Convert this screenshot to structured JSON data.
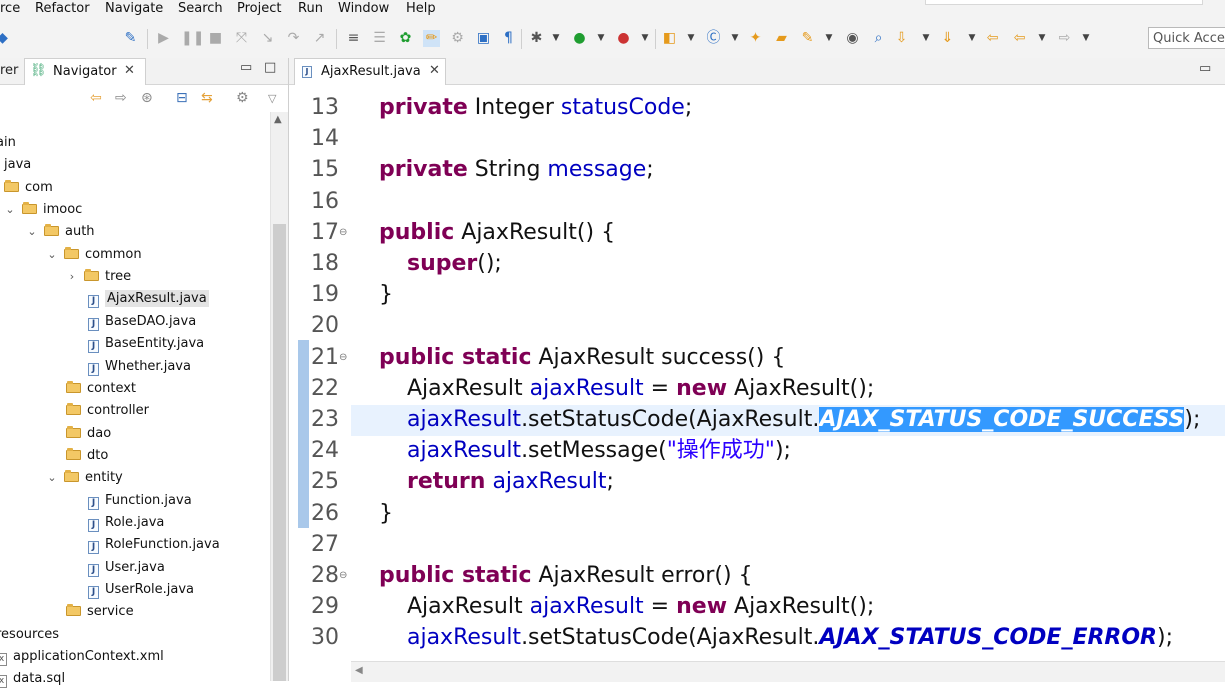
{
  "menu": [
    "rce",
    "Refactor",
    "Navigate",
    "Search",
    "Project",
    "Run",
    "Window",
    "Help"
  ],
  "quick_access": "Quick Access",
  "navigator": {
    "prev_tab": "rer",
    "tab_label": "Navigator",
    "tree": [
      {
        "label": "ain",
        "kind": "text",
        "indent": 0
      },
      {
        "label": "java",
        "kind": "text",
        "indent": 1
      },
      {
        "label": "com",
        "kind": "folder",
        "indent": 1
      },
      {
        "label": "imooc",
        "kind": "folder",
        "indent": 2,
        "expanded": true
      },
      {
        "label": "auth",
        "kind": "folder",
        "indent": 3,
        "expanded": true
      },
      {
        "label": "common",
        "kind": "folder",
        "indent": 4,
        "expanded": true
      },
      {
        "label": "tree",
        "kind": "folder",
        "indent": 5,
        "expanded": false
      },
      {
        "label": "AjaxResult.java",
        "kind": "java",
        "indent": 6,
        "selected": true
      },
      {
        "label": "BaseDAO.java",
        "kind": "java",
        "indent": 6
      },
      {
        "label": "BaseEntity.java",
        "kind": "java",
        "indent": 6
      },
      {
        "label": "Whether.java",
        "kind": "java",
        "indent": 6
      },
      {
        "label": "context",
        "kind": "folder",
        "indent": 5
      },
      {
        "label": "controller",
        "kind": "folder",
        "indent": 5
      },
      {
        "label": "dao",
        "kind": "folder",
        "indent": 5
      },
      {
        "label": "dto",
        "kind": "folder",
        "indent": 5
      },
      {
        "label": "entity",
        "kind": "folder",
        "indent": 4,
        "expanded": true
      },
      {
        "label": "Function.java",
        "kind": "java",
        "indent": 6
      },
      {
        "label": "Role.java",
        "kind": "java",
        "indent": 6
      },
      {
        "label": "RoleFunction.java",
        "kind": "java",
        "indent": 6
      },
      {
        "label": "User.java",
        "kind": "java",
        "indent": 6
      },
      {
        "label": "UserRole.java",
        "kind": "java",
        "indent": 6
      },
      {
        "label": "service",
        "kind": "folder",
        "indent": 5
      },
      {
        "label": "resources",
        "kind": "text",
        "indent": 0
      },
      {
        "label": "applicationContext.xml",
        "kind": "xml",
        "indent": 0
      },
      {
        "label": "data.sql",
        "kind": "xml",
        "indent": 0
      }
    ]
  },
  "editor": {
    "tab_label": "AjaxResult.java",
    "lines": [
      {
        "n": "13",
        "fold": false,
        "tokens": [
          [
            "kw",
            "private"
          ],
          [
            "",
            " Integer "
          ],
          [
            "fld",
            "statusCode"
          ],
          [
            "",
            ";"
          ]
        ]
      },
      {
        "n": "14",
        "fold": false,
        "tokens": []
      },
      {
        "n": "15",
        "fold": false,
        "tokens": [
          [
            "kw",
            "private"
          ],
          [
            "",
            " String "
          ],
          [
            "fld",
            "message"
          ],
          [
            "",
            ";"
          ]
        ]
      },
      {
        "n": "16",
        "fold": false,
        "tokens": []
      },
      {
        "n": "17",
        "fold": true,
        "tokens": [
          [
            "kw",
            "public"
          ],
          [
            "",
            " AjaxResult() {"
          ]
        ]
      },
      {
        "n": "18",
        "fold": false,
        "tokens": [
          [
            "",
            "    "
          ],
          [
            "kw",
            "super"
          ],
          [
            "",
            "();"
          ]
        ]
      },
      {
        "n": "19",
        "fold": false,
        "tokens": [
          [
            "",
            "}"
          ]
        ]
      },
      {
        "n": "20",
        "fold": false,
        "tokens": []
      },
      {
        "n": "21",
        "fold": true,
        "tokens": [
          [
            "kw",
            "public static"
          ],
          [
            "",
            " AjaxResult success() {"
          ]
        ]
      },
      {
        "n": "22",
        "fold": false,
        "tokens": [
          [
            "",
            "    AjaxResult "
          ],
          [
            "fld",
            "ajaxResult"
          ],
          [
            "",
            " = "
          ],
          [
            "kw",
            "new"
          ],
          [
            "",
            " AjaxResult();"
          ]
        ]
      },
      {
        "n": "23",
        "fold": false,
        "tokens": [
          [
            "",
            "    "
          ],
          [
            "fld",
            "ajaxResult"
          ],
          [
            "",
            ".setStatusCode(AjaxResult."
          ],
          [
            "sel-hl",
            "AJAX_STATUS_CODE_SUCCESS"
          ],
          [
            "",
            ");"
          ]
        ]
      },
      {
        "n": "24",
        "fold": false,
        "tokens": [
          [
            "",
            "    "
          ],
          [
            "fld",
            "ajaxResult"
          ],
          [
            "",
            ".setMessage("
          ],
          [
            "str",
            "\"操作成功\""
          ],
          [
            "",
            ");"
          ]
        ]
      },
      {
        "n": "25",
        "fold": false,
        "tokens": [
          [
            "",
            "    "
          ],
          [
            "kw",
            "return"
          ],
          [
            "",
            " "
          ],
          [
            "fld",
            "ajaxResult"
          ],
          [
            "",
            ";"
          ]
        ]
      },
      {
        "n": "26",
        "fold": false,
        "tokens": [
          [
            "",
            "}"
          ]
        ]
      },
      {
        "n": "27",
        "fold": false,
        "tokens": []
      },
      {
        "n": "28",
        "fold": true,
        "tokens": [
          [
            "kw",
            "public static"
          ],
          [
            "",
            " AjaxResult error() {"
          ]
        ]
      },
      {
        "n": "29",
        "fold": false,
        "tokens": [
          [
            "",
            "    AjaxResult "
          ],
          [
            "fld",
            "ajaxResult"
          ],
          [
            "",
            " = "
          ],
          [
            "kw",
            "new"
          ],
          [
            "",
            " AjaxResult();"
          ]
        ]
      },
      {
        "n": "30",
        "fold": false,
        "tokens": [
          [
            "",
            "    "
          ],
          [
            "fld",
            "ajaxResult"
          ],
          [
            "",
            ".setStatusCode(AjaxResult."
          ],
          [
            "cst",
            "AJAX_STATUS_CODE_ERROR"
          ],
          [
            "",
            ");"
          ]
        ]
      }
    ]
  },
  "colors": {
    "keyword": "#7f0055",
    "field": "#0000c0",
    "string": "#2a00ff",
    "selection": "#3399ff",
    "current_line": "#e8f2fe"
  }
}
